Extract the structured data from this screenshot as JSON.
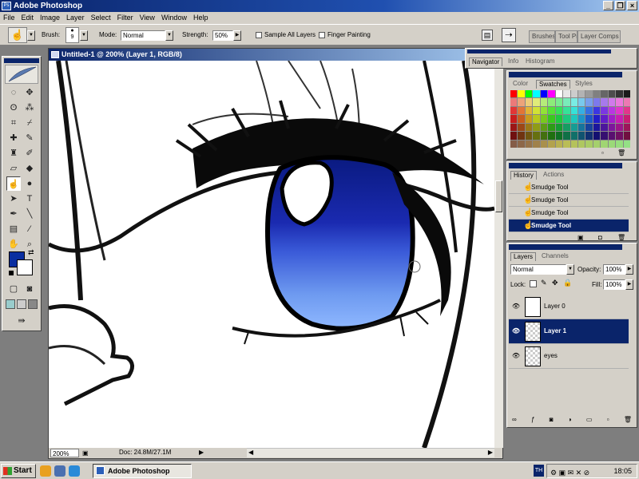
{
  "app": {
    "title": "Adobe Photoshop"
  },
  "menu": [
    "File",
    "Edit",
    "Image",
    "Layer",
    "Select",
    "Filter",
    "View",
    "Window",
    "Help"
  ],
  "options": {
    "brush_label": "Brush:",
    "brush_size": "9",
    "mode_label": "Mode:",
    "mode_value": "Normal",
    "strength_label": "Strength:",
    "strength_value": "50%",
    "sample_all_layers": "Sample All Layers",
    "finger_painting": "Finger Painting",
    "panel_well_tabs": [
      "Brushes",
      "Tool Pr",
      "Layer Comps"
    ]
  },
  "document": {
    "title": "Untitled-1 @ 200% (Layer 1, RGB/8)",
    "zoom": "200%",
    "doc_size": "Doc: 24.8M/27.1M"
  },
  "navigator": {
    "tabs": [
      "Navigator",
      "Info",
      "Histogram"
    ]
  },
  "color_panel": {
    "tabs": [
      "Color",
      "Swatches",
      "Styles"
    ]
  },
  "history": {
    "tabs": [
      "History",
      "Actions"
    ],
    "items": [
      "Smudge Tool",
      "Smudge Tool",
      "Smudge Tool",
      "Smudge Tool"
    ],
    "selected_index": 3
  },
  "layers": {
    "tabs": [
      "Layers",
      "Channels"
    ],
    "blend_mode": "Normal",
    "opacity_label": "Opacity:",
    "opacity": "100%",
    "lock_label": "Lock:",
    "fill_label": "Fill:",
    "fill": "100%",
    "items": [
      "Layer 0",
      "Layer 1",
      "eyes"
    ],
    "selected_index": 1
  },
  "colors": {
    "foreground": "#0a2ea0",
    "background": "#ffffff",
    "accent": "#0a246a"
  },
  "taskbar": {
    "start": "Start",
    "app": "Adobe Photoshop",
    "tray_badge": "TH",
    "clock": "18:05"
  }
}
